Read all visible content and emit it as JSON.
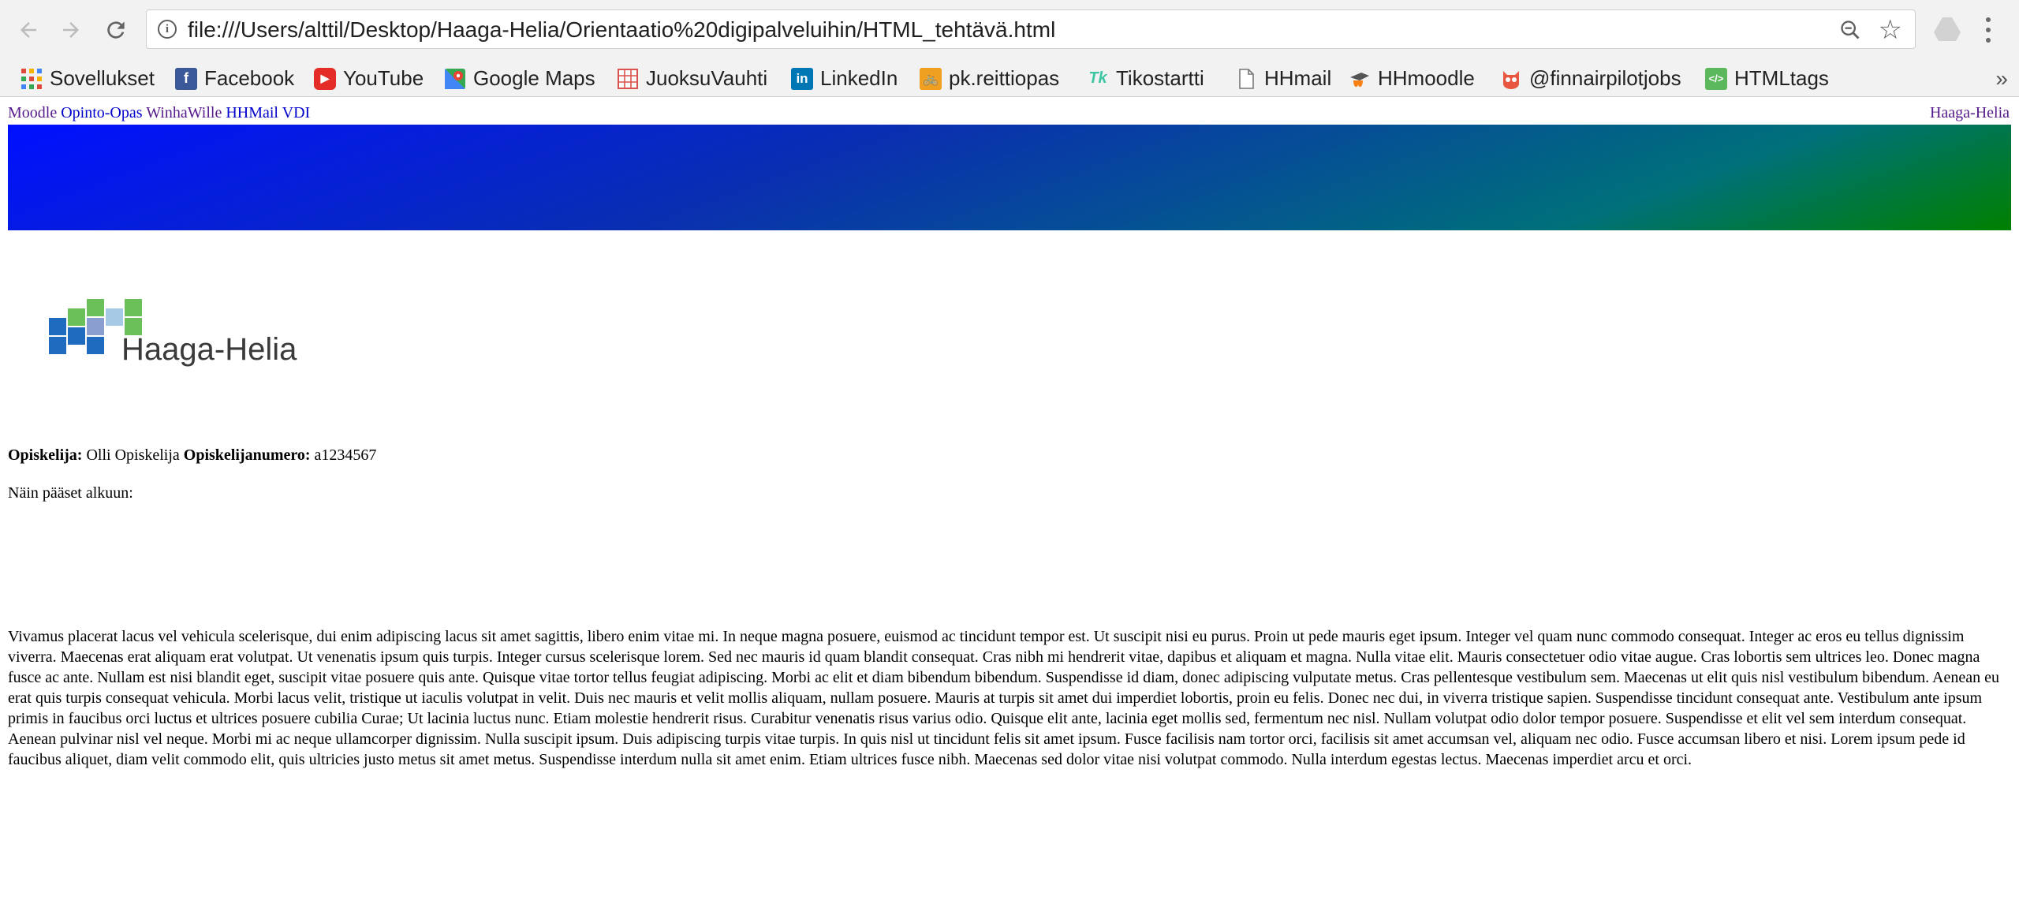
{
  "browser": {
    "url": "file:///Users/alttil/Desktop/Haaga-Helia/Orientaatio%20digipalveluihin/HTML_tehtävä.html",
    "info_icon": "i",
    "bookmarks": [
      {
        "label": "Sovellukset",
        "icon": "apps-grid-icon",
        "color": "#e04a3a"
      },
      {
        "label": "Facebook",
        "icon": "facebook-icon",
        "color": "#3b5998"
      },
      {
        "label": "YouTube",
        "icon": "youtube-icon",
        "color": "#e52d27"
      },
      {
        "label": "Google Maps",
        "icon": "google-maps-icon",
        "color": "#34a853"
      },
      {
        "label": "JuoksuVauhti",
        "icon": "calculator-icon",
        "color": "#d9534f"
      },
      {
        "label": "LinkedIn",
        "icon": "linkedin-icon",
        "color": "#0077b5"
      },
      {
        "label": "pk.reittiopas",
        "icon": "bike-icon",
        "color": "#f0a020"
      },
      {
        "label": "Tikostartti",
        "icon": "tiko-icon",
        "color": "#3cc6a4"
      },
      {
        "label": "HHmail",
        "icon": "document-icon",
        "color": "#888888"
      },
      {
        "label": "HHmoodle",
        "icon": "moodle-icon",
        "color": "#f98012"
      },
      {
        "label": "@finnairpilotjobs",
        "icon": "owl-icon",
        "color": "#e8563f"
      },
      {
        "label": "HTMLtags",
        "icon": "htmltags-icon",
        "color": "#5cb85c"
      }
    ],
    "more": "»"
  },
  "page": {
    "nav_links": [
      "Moodle",
      "Opinto-Opas",
      "WinhaWille",
      "HHMail",
      "VDI"
    ],
    "right_link": "Haaga-Helia",
    "logo_text": "Haaga-Helia",
    "student_label": "Opiskelija:",
    "student_name": "Olli Opiskelija",
    "number_label": "Opiskelijanumero:",
    "number_value": "a1234567",
    "howto": "Näin pääset alkuun:",
    "lorem": "Vivamus placerat lacus vel vehicula scelerisque, dui enim adipiscing lacus sit amet sagittis, libero enim vitae mi. In neque magna posuere, euismod ac tincidunt tempor est. Ut suscipit nisi eu purus. Proin ut pede mauris eget ipsum. Integer vel quam nunc commodo consequat. Integer ac eros eu tellus dignissim viverra. Maecenas erat aliquam erat volutpat. Ut venenatis ipsum quis turpis. Integer cursus scelerisque lorem. Sed nec mauris id quam blandit consequat. Cras nibh mi hendrerit vitae, dapibus et aliquam et magna. Nulla vitae elit. Mauris consectetuer odio vitae augue. Cras lobortis sem ultrices leo. Donec magna fusce ac ante. Nullam est nisi blandit eget, suscipit vitae posuere quis ante. Quisque vitae tortor tellus feugiat adipiscing. Morbi ac elit et diam bibendum bibendum. Suspendisse id diam, donec adipiscing vulputate metus. Cras pellentesque vestibulum sem. Maecenas ut elit quis nisl vestibulum bibendum. Aenean eu erat quis turpis consequat vehicula. Morbi lacus velit, tristique ut iaculis volutpat in velit. Duis nec mauris et velit mollis aliquam, nullam posuere. Mauris at turpis sit amet dui imperdiet lobortis, proin eu felis. Donec nec dui, in viverra tristique sapien. Suspendisse tincidunt consequat ante. Vestibulum ante ipsum primis in faucibus orci luctus et ultrices posuere cubilia Curae; Ut lacinia luctus nunc. Etiam molestie hendrerit risus. Curabitur venenatis risus varius odio. Quisque elit ante, lacinia eget mollis sed, fermentum nec nisl. Nullam volutpat odio dolor tempor posuere. Suspendisse et elit vel sem interdum consequat. Aenean pulvinar nisl vel neque. Morbi mi ac neque ullamcorper dignissim. Nulla suscipit ipsum. Duis adipiscing turpis vitae turpis. In quis nisl ut tincidunt felis sit amet ipsum. Fusce facilisis nam tortor orci, facilisis sit amet accumsan vel, aliquam nec odio. Fusce accumsan libero et nisi. Lorem ipsum pede id faucibus aliquet, diam velit commodo elit, quis ultricies justo metus sit amet metus. Suspendisse interdum nulla sit amet enim. Etiam ultrices fusce nibh. Maecenas sed dolor vitae nisi volutpat commodo. Nulla interdum egestas lectus. Maecenas imperdiet arcu et orci."
  }
}
